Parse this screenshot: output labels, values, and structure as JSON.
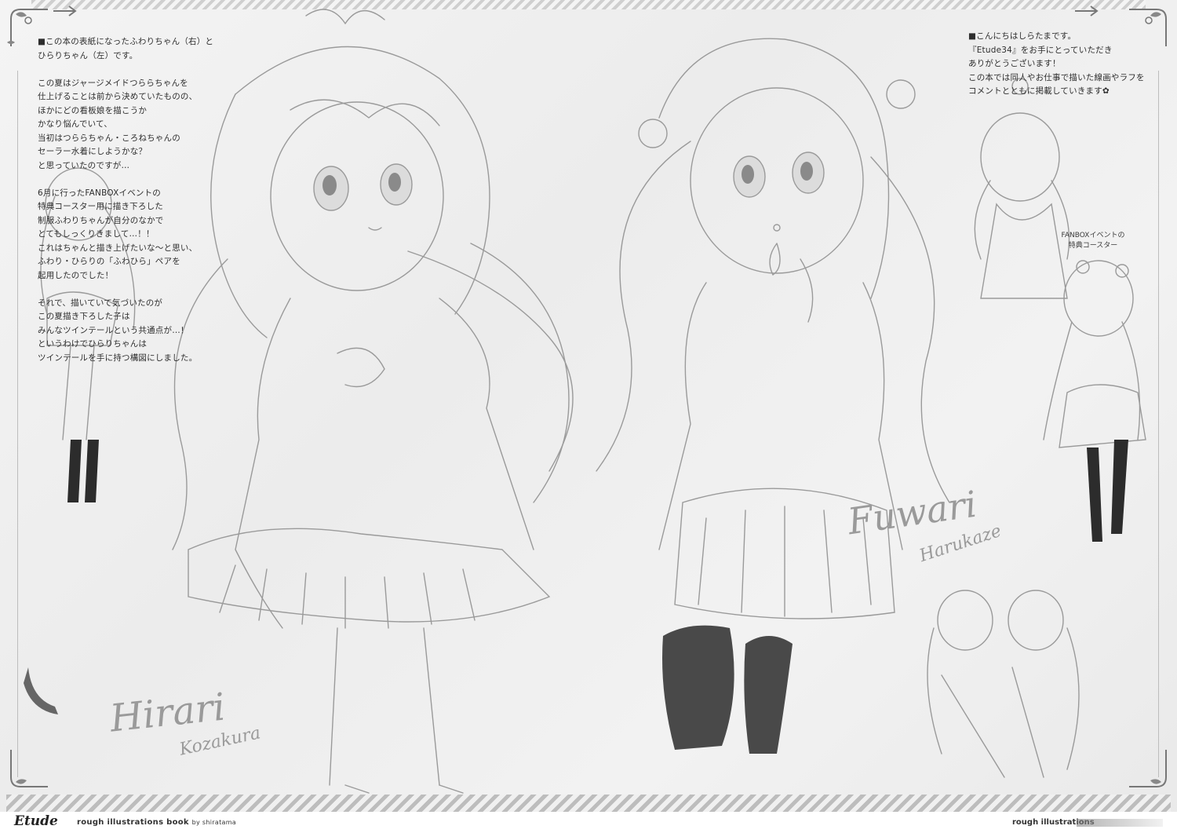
{
  "left_text": [
    "■この本の表紙になったふわりちゃん（右）と",
    "ひらりちゃん（左）です。",
    "",
    "この夏はジャージメイドつららちゃんを",
    "仕上げることは前から決めていたものの、",
    "ほかにどの看板娘を描こうか",
    "かなり悩んでいて、",
    "当初はつららちゃん・ころねちゃんの",
    "セーラー水着にしようかな？",
    "と思っていたのですが…",
    "",
    "6月に行ったFANBOXイベントの",
    "特典コースター用に描き下ろした",
    "制服ふわりちゃんが自分のなかで",
    "とてもしっくりきまして…！！",
    "これはちゃんと描き上げたいな〜と思い、",
    "ふわり・ひらりの「ふわひら」ペアを",
    "起用したのでした！",
    "",
    "それで、描いていて気づいたのが",
    "この夏描き下ろした子は",
    "みんなツインテールという共通点が…！",
    "というわけでひらりちゃんは",
    "ツインテールを手に持つ構図にしました。"
  ],
  "right_text": [
    "■こんにちはしらたまです。",
    "『Etude34』をお手にとっていただき",
    "ありがとうございます！",
    "この本では同人やお仕事で描いた線画やラフを",
    "コメントとともに掲載していきます✿"
  ],
  "caption": [
    "FANBOXイベントの",
    "特典コースター"
  ],
  "signatures": {
    "fuwari_first": "Fuwari",
    "fuwari_last": "Harukaze",
    "hirari_first": "Hirari",
    "hirari_last": "Kozakura"
  },
  "footer": {
    "brand": "Etude",
    "subtitle": "rough illustrations book",
    "by": "by shiratama",
    "right": "rough illustrations"
  },
  "colors": {
    "background": "#f0f0f0",
    "line_art": "#8c8c8c",
    "dark_stockings": "#2a2a2a",
    "signature": "#9a9a9a"
  }
}
